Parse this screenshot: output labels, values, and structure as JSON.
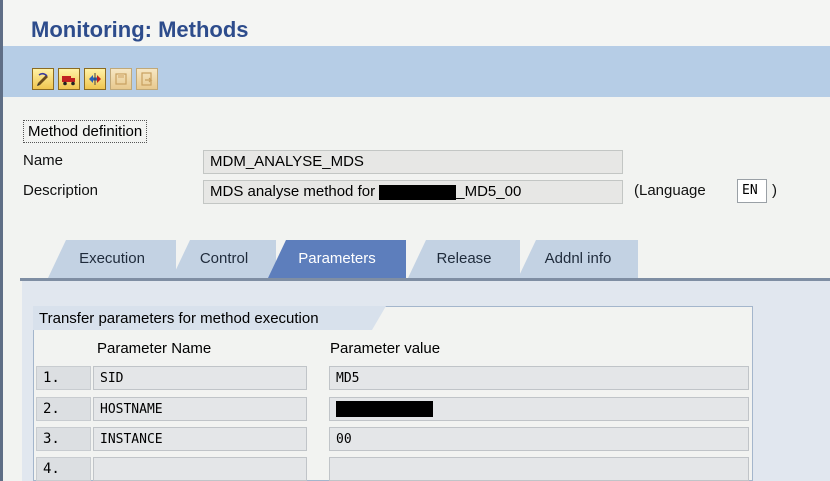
{
  "page_title": "Monitoring: Methods",
  "toolbar": {
    "buttons": [
      {
        "icon": "edit-pencil-icon",
        "enabled": true
      },
      {
        "icon": "transport-truck-icon",
        "enabled": true
      },
      {
        "icon": "navigate-arrows-icon",
        "enabled": true
      },
      {
        "icon": "save-local-icon",
        "enabled": false
      },
      {
        "icon": "export-icon",
        "enabled": false
      }
    ]
  },
  "method_definition": {
    "group_title": "Method definition",
    "name_label": "Name",
    "name_value": "MDM_ANALYSE_MDS",
    "description_label": "Description",
    "description_prefix": "MDS analyse method for ",
    "description_suffix": "_MD5_00",
    "language_label": "(Language",
    "language_value": "EN",
    "language_close": ")"
  },
  "tabs": [
    {
      "label": "Execution",
      "active": false
    },
    {
      "label": "Control",
      "active": false
    },
    {
      "label": "Parameters",
      "active": true
    },
    {
      "label": "Release",
      "active": false
    },
    {
      "label": "Addnl info",
      "active": false
    }
  ],
  "parameters_panel": {
    "title": "Transfer parameters for method execution",
    "col_name": "Parameter Name",
    "col_value": "Parameter value",
    "rows": [
      {
        "num": "1.",
        "name": "SID",
        "value": "MD5",
        "redacted": false
      },
      {
        "num": "2.",
        "name": "HOSTNAME",
        "value": "",
        "redacted": true
      },
      {
        "num": "3.",
        "name": "INSTANCE",
        "value": "00",
        "redacted": false
      },
      {
        "num": "4.",
        "name": "",
        "value": "",
        "redacted": false
      }
    ]
  },
  "colors": {
    "title": "#2d4c8c",
    "toolbar_bg": "#b6cde6",
    "active_tab": "#5d7ebc",
    "inactive_tab": "#c3d2e3"
  }
}
